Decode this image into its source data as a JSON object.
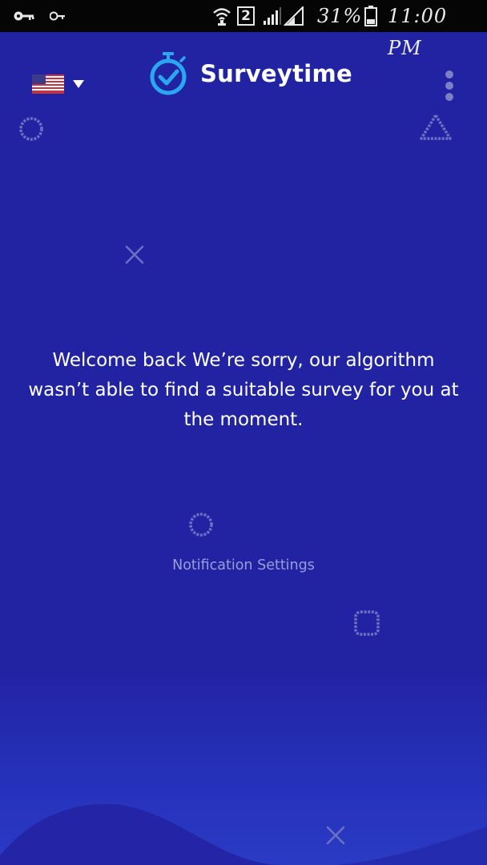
{
  "status_bar": {
    "sim_slot": "2",
    "battery_percent": "31%",
    "time": "11:00 PM",
    "icons": [
      "vpn-key-icon",
      "key-icon",
      "wifi-icon",
      "sim-2-icon",
      "signal-icon",
      "signal-icon",
      "battery-icon"
    ]
  },
  "header": {
    "language_flag": "us-flag-icon",
    "brand_name": "Surveytime",
    "brand_color": "#29a8f0"
  },
  "main": {
    "message": "Welcome back We’re sorry, our algorithm wasn’t able to find a suitable survey for you at the moment.",
    "notification_link": "Notification Settings"
  },
  "colors": {
    "background": "#2223a3",
    "status_bar": "#050505",
    "link": "#9b9dd8",
    "decoration": "#6e70c4"
  }
}
